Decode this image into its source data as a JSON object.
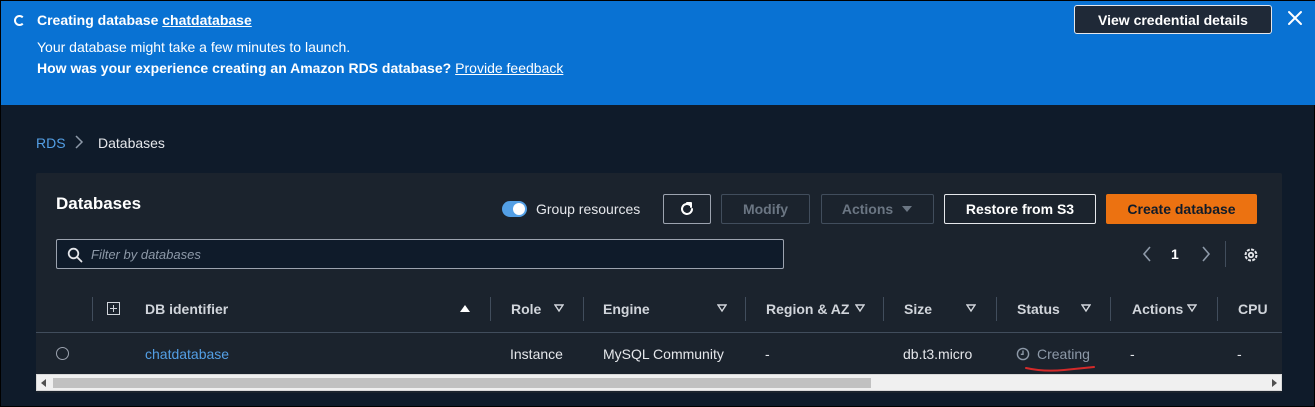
{
  "banner": {
    "title_prefix": "Creating database ",
    "title_db": "chatdatabase",
    "line1": "Your database might take a few minutes to launch.",
    "line2": "How was your experience creating an Amazon RDS database?",
    "feedback_link": "Provide feedback",
    "credentials_button": "View credential details",
    "icons": {
      "loading": "spinner-icon",
      "close": "close-icon"
    },
    "color": "#0972d3"
  },
  "breadcrumb": {
    "root": "RDS",
    "current": "Databases",
    "separator_icon": "chevron-right-icon"
  },
  "panel": {
    "title": "Databases",
    "group_toggle_label": "Group resources",
    "group_toggle_on": true,
    "buttons": {
      "refresh_icon": "refresh-icon",
      "modify": "Modify",
      "actions": "Actions",
      "restore": "Restore from S3",
      "create": "Create database"
    },
    "search_placeholder": "Filter by databases",
    "pagination": {
      "current_page": "1"
    },
    "accent_color": "#ec7211"
  },
  "table": {
    "columns": [
      "DB identifier",
      "Role",
      "Engine",
      "Region & AZ",
      "Size",
      "Status",
      "Actions",
      "CPU"
    ],
    "rows": [
      {
        "db_identifier": "chatdatabase",
        "role": "Instance",
        "engine": "MySQL Community",
        "region_az": "-",
        "size": "db.t3.micro",
        "status": "Creating",
        "actions": "-",
        "cpu": "-"
      }
    ]
  }
}
